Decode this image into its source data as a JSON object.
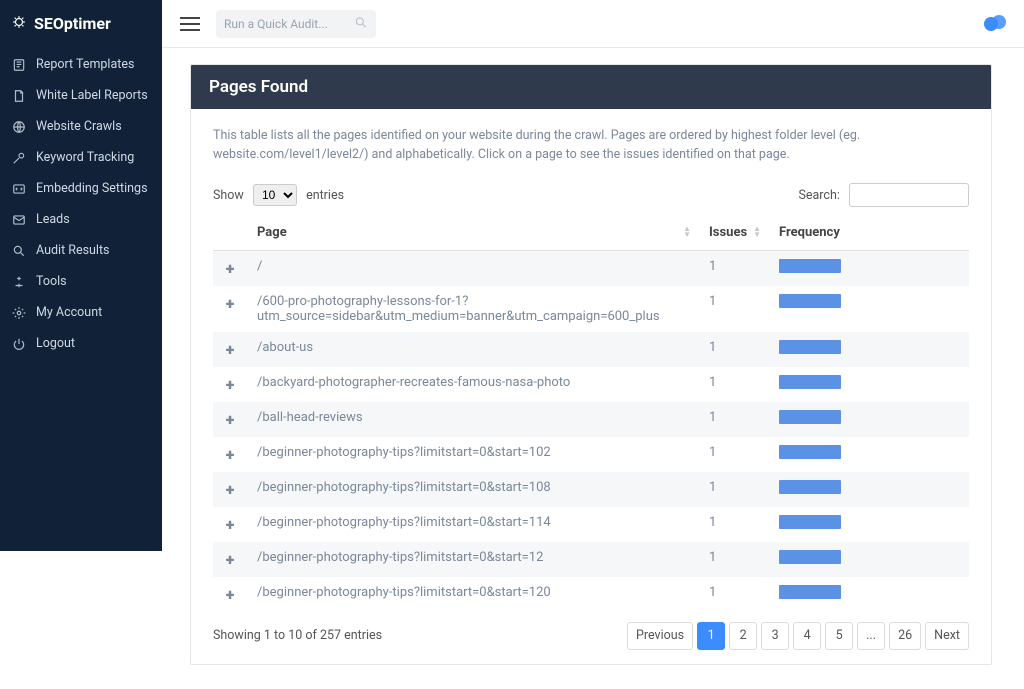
{
  "brand": "SEOptimer",
  "topbar": {
    "quick_placeholder": "Run a Quick Audit..."
  },
  "sidebar": {
    "items": [
      {
        "label": "Report Templates",
        "icon": "template-icon"
      },
      {
        "label": "White Label Reports",
        "icon": "document-icon"
      },
      {
        "label": "Website Crawls",
        "icon": "globe-icon"
      },
      {
        "label": "Keyword Tracking",
        "icon": "key-icon"
      },
      {
        "label": "Embedding Settings",
        "icon": "embed-icon"
      },
      {
        "label": "Leads",
        "icon": "mail-icon"
      },
      {
        "label": "Audit Results",
        "icon": "search-icon"
      },
      {
        "label": "Tools",
        "icon": "tool-icon"
      },
      {
        "label": "My Account",
        "icon": "gear-icon"
      },
      {
        "label": "Logout",
        "icon": "logout-icon"
      }
    ]
  },
  "panel": {
    "title": "Pages Found",
    "description": "This table lists all the pages identified on your website during the crawl. Pages are ordered by highest folder level (eg. website.com/level1/level2/) and alphabetically. Click on a page to see the issues identified on that page.",
    "show_label": "Show",
    "entries_label": "entries",
    "per_page_value": "10",
    "search_label": "Search:",
    "columns": {
      "page": "Page",
      "issues": "Issues",
      "frequency": "Frequency"
    },
    "rows": [
      {
        "page": "/",
        "issues": "1"
      },
      {
        "page": "/600-pro-photography-lessons-for-1?utm_source=sidebar&utm_medium=banner&utm_campaign=600_plus",
        "issues": "1"
      },
      {
        "page": "/about-us",
        "issues": "1"
      },
      {
        "page": "/backyard-photographer-recreates-famous-nasa-photo",
        "issues": "1"
      },
      {
        "page": "/ball-head-reviews",
        "issues": "1"
      },
      {
        "page": "/beginner-photography-tips?limitstart=0&start=102",
        "issues": "1"
      },
      {
        "page": "/beginner-photography-tips?limitstart=0&start=108",
        "issues": "1"
      },
      {
        "page": "/beginner-photography-tips?limitstart=0&start=114",
        "issues": "1"
      },
      {
        "page": "/beginner-photography-tips?limitstart=0&start=12",
        "issues": "1"
      },
      {
        "page": "/beginner-photography-tips?limitstart=0&start=120",
        "issues": "1"
      }
    ],
    "info": "Showing 1 to 10 of 257 entries",
    "pager": {
      "prev": "Previous",
      "next": "Next",
      "pages": [
        "1",
        "2",
        "3",
        "4",
        "5",
        "...",
        "26"
      ],
      "active_index": 0
    }
  }
}
